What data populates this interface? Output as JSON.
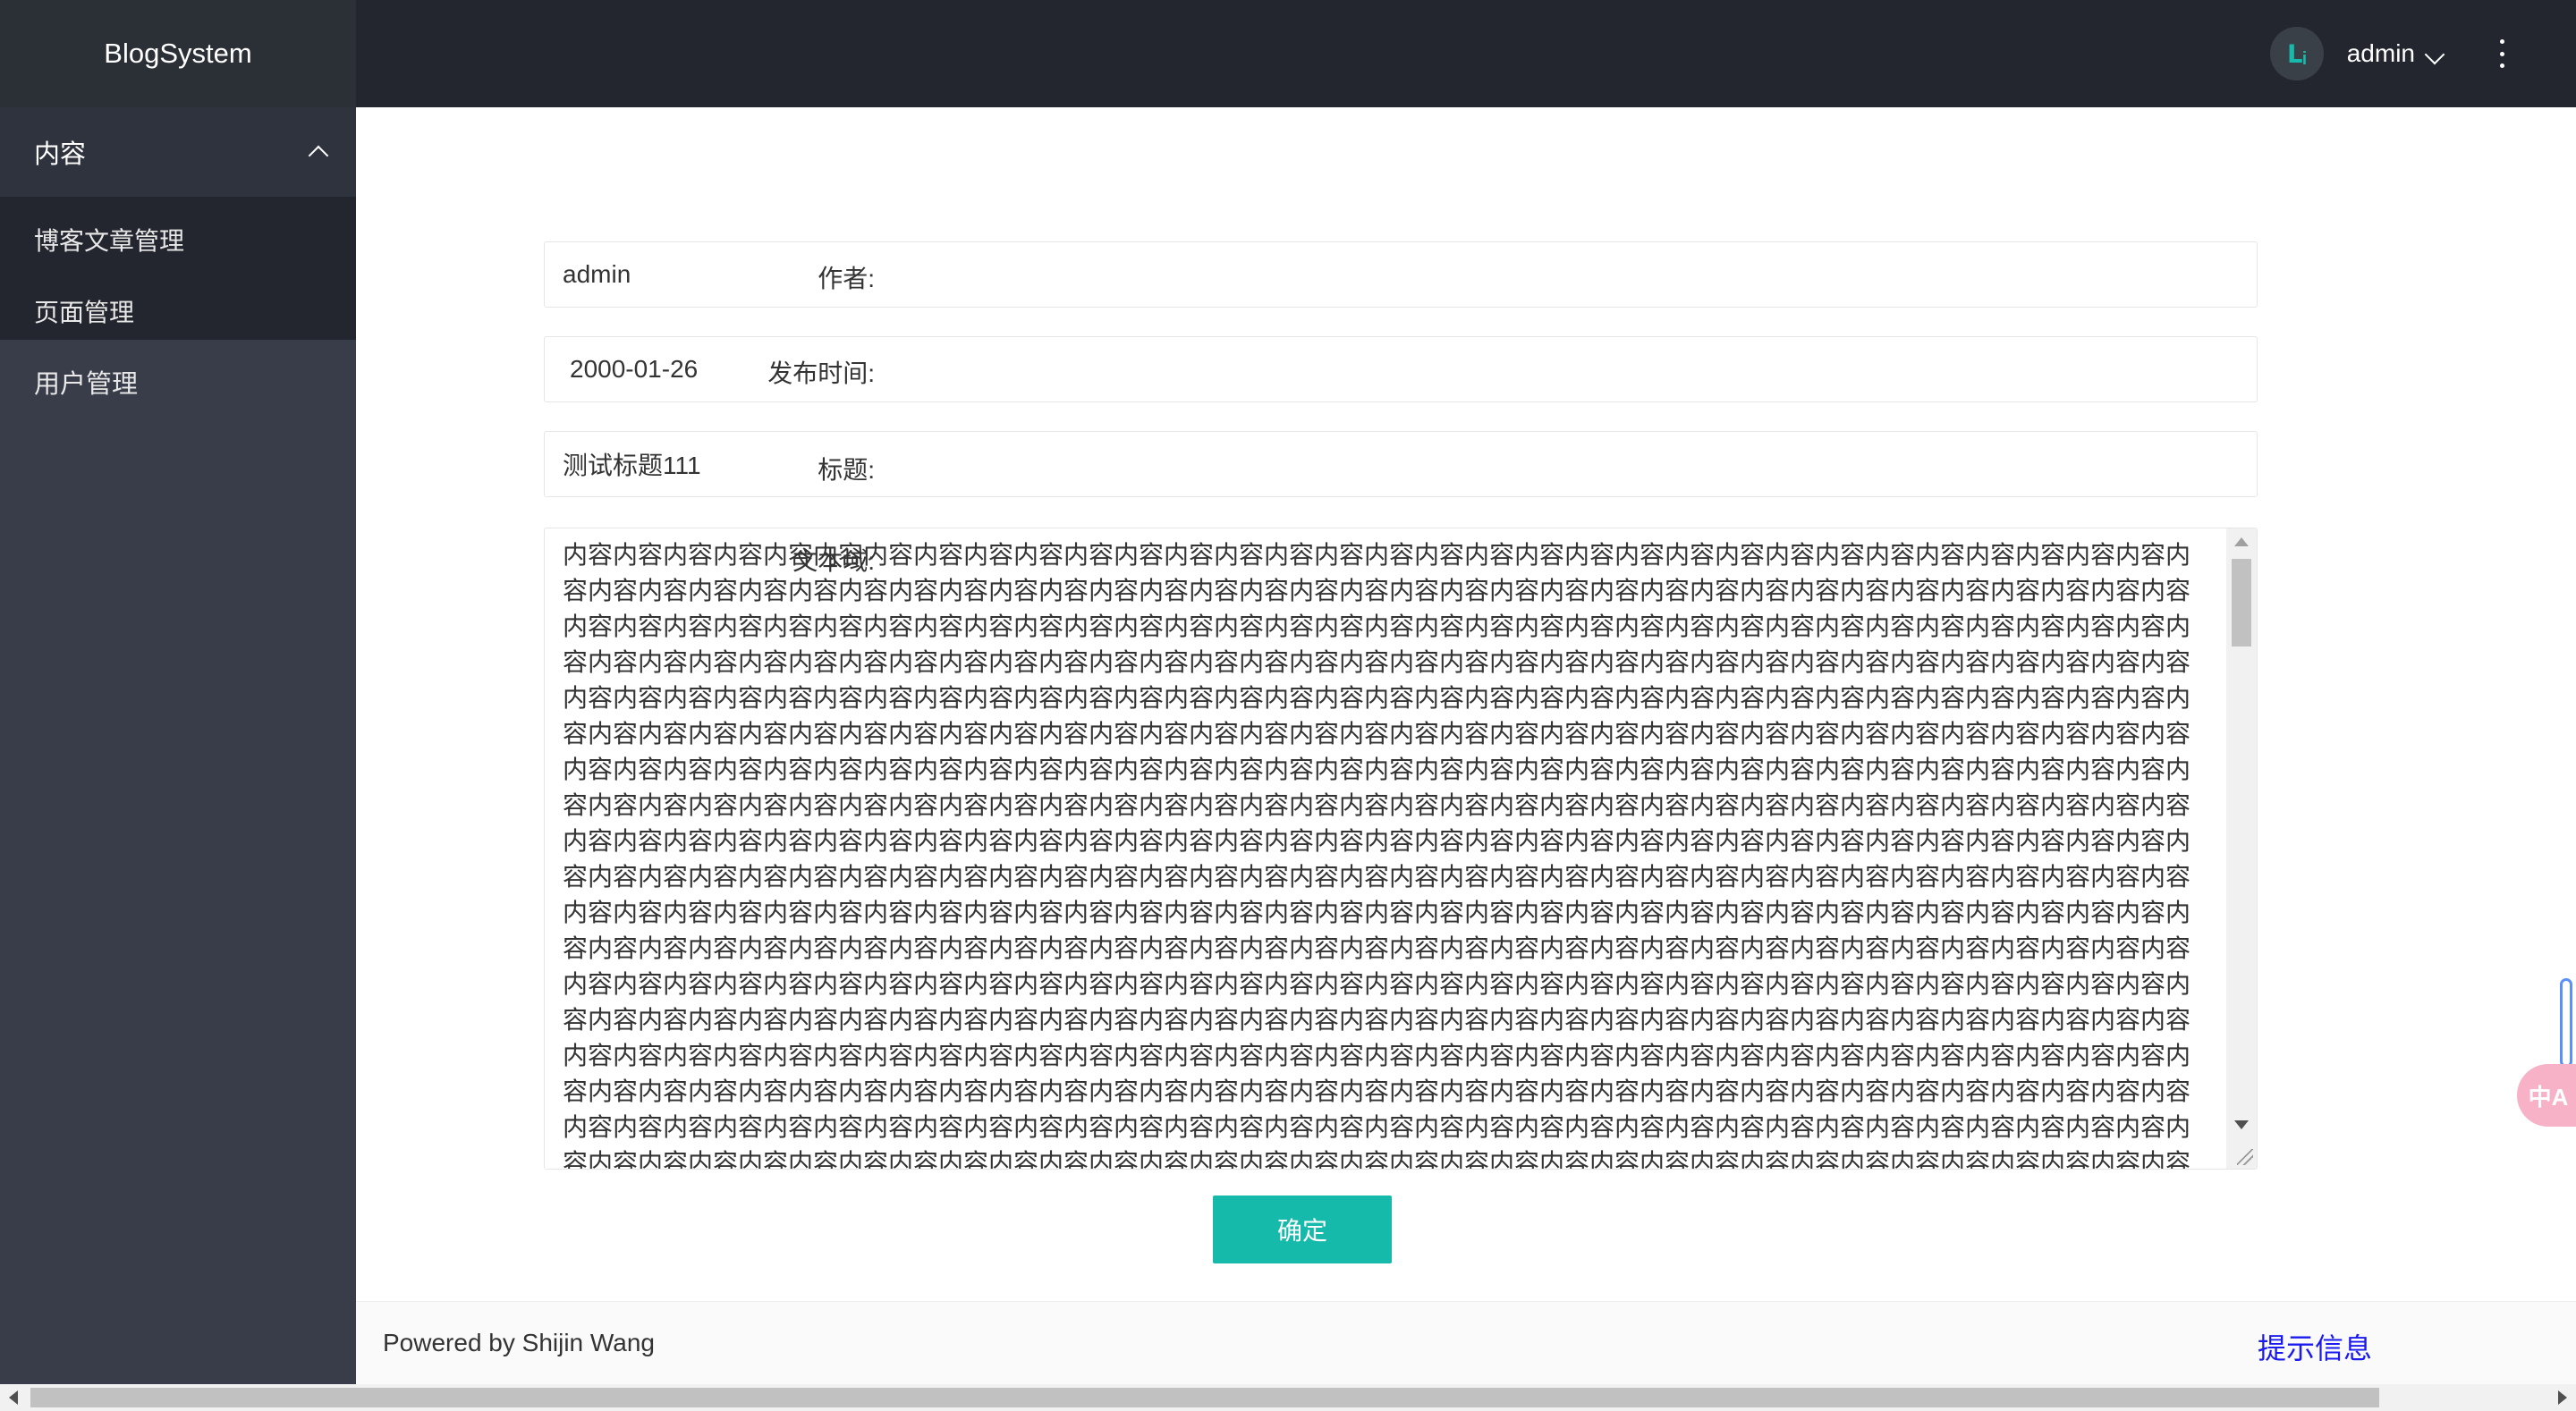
{
  "header": {
    "app_title": "BlogSystem",
    "avatar_glyph": "ᒪᵢ",
    "user_name": "admin"
  },
  "sidebar": {
    "group_label": "内容",
    "sub_items": [
      {
        "label": "博客文章管理"
      },
      {
        "label": "页面管理"
      }
    ],
    "items": [
      {
        "label": "用户管理"
      }
    ]
  },
  "form": {
    "author_label": "作者:",
    "author_value": "admin",
    "date_label": "发布时间:",
    "date_value": "2000-01-26",
    "title_label": "标题:",
    "title_value": "测试标题111",
    "content_label": "文本域:",
    "content_value": "内容内容内容内容内容内容内容内容内容内容内容内容内容内容内容内容内容内容内容内容内容内容内容内容内容内容内容内容内容内容内容内容内容内容内容内容内容内容内容内容内容内容内容内容内容内容内容内容内容内容内容内容内容内容内容内容内容内容内容内容内容内容内容内容内容内容内容内容内容内容内容内容内容内容内容内容内容内容内容内容内容内容内容内容内容内容内容内容内容内容内容内容内容内容内容内容内容内容内容内容内容内容内容内容内容内容内容内容内容内容内容内容内容内容内容内容内容内容内容内容内容内容内容内容内容内容内容内容内容内容内容内容内容内容内容内容内容内容内容内容内容内容内容内容内容内容内容内容内容内容内容内容内容内容内容内容内容内容内容内容内容内容内容内容内容内容内容内容内容内容内容内容内容内容内容内容内容内容内容内容内容内容内容内容内容内容内容内容内容内容内容内容内容内容内容内容内容内容内容内容内容内容内容内容内容内容内容内容内容内容内容内容内容内容内容内容内容内容内容内容内容内容内容内容内容内容内容内容内容内容内容内容内容内容内容内容内容内容内容内容内容内容内容内容内容内容内容内容内容内容内容内容内容内容内容内容内容内容内容内容内容内容内容内容内容内容内容内容内容内容内容内容内容内容内容内容内容内容内容内容内容内容内容内容内容内容内容内容内容内容内容内容内容内容内容内容内容内容内容内容内容内容内容内容内容内容内容内容内容内容内容内容内容内容内容内容内容内容内容内容内容内容内容内容内容内容内容内容内容内容内容内容内容内容内容内容内容内容内容内容内容内容内容内容内容内容内容内容内容内容内容内容内容内容内容内容内容内容内容内容内容内容内容内容内容内容内容内容内容内容内容内容内容内容内容内容内容内容内容内容内容内容内容内容内容内容内容内容内容内容内容内容内容内容内容内容内容内容内容内容内容内容内容内容内容内容内容内容内容内容内容内容内容内容内容内容内容内容内容内容内容内容内容内容内容内容内容内容内容内容内容内容内容内容内容内容内容内容内容内容内容内容内容内容内容内容内容内容内容内容内容内容内容内容内容内容内容内容内容内容内容内容内容内容内容内容内容内容内容内容内容内容内容内容内容内容内容内容内容内容内容内容内容内容内容内容内容内容内容内容内容内容内容内容内容内容内容内容内容内容内容内容内容内容内容内容内容内容内容内容内容内容内容内容内容内容内容内容内容内容内容内容内容内容内容内容内容内容内容内容内容内容内容内容内容内容内容内容内容内容内容内容内容内容内容内容内容内容内容内容内容内容内容内容内容内容内容内容内容内容内容内容内容内容内容内容内容内容内容内容内容内容内容内容内容内容内容内容内容内容内容内容内容内容内容内容内容内容内容内容内容内容内容内容内容内容内容内容内容内容内容内容内容内容内容内容内容内容内容内容内容内容内容内容内容内容内容内容内容内容内容内容内容内容内容内容内容内容内容内容内容内容内容内容内容内容内容内容内容内容内容内容内容内容内容内容内容内容内容内容内容内容内容内容内容内容内容内容内容内容内容内容内容内容内容内容内容内容内容内容内容",
    "submit_label": "确定"
  },
  "footer": {
    "powered_by": "Powered by Shijin Wang",
    "tip_link": "提示信息"
  },
  "widgets": {
    "translate_glyph": "中A"
  },
  "colors": {
    "accent": "#16baaa",
    "header_bg": "#23262e",
    "sidebar_bg": "#393d49",
    "link": "#1a1aee"
  }
}
